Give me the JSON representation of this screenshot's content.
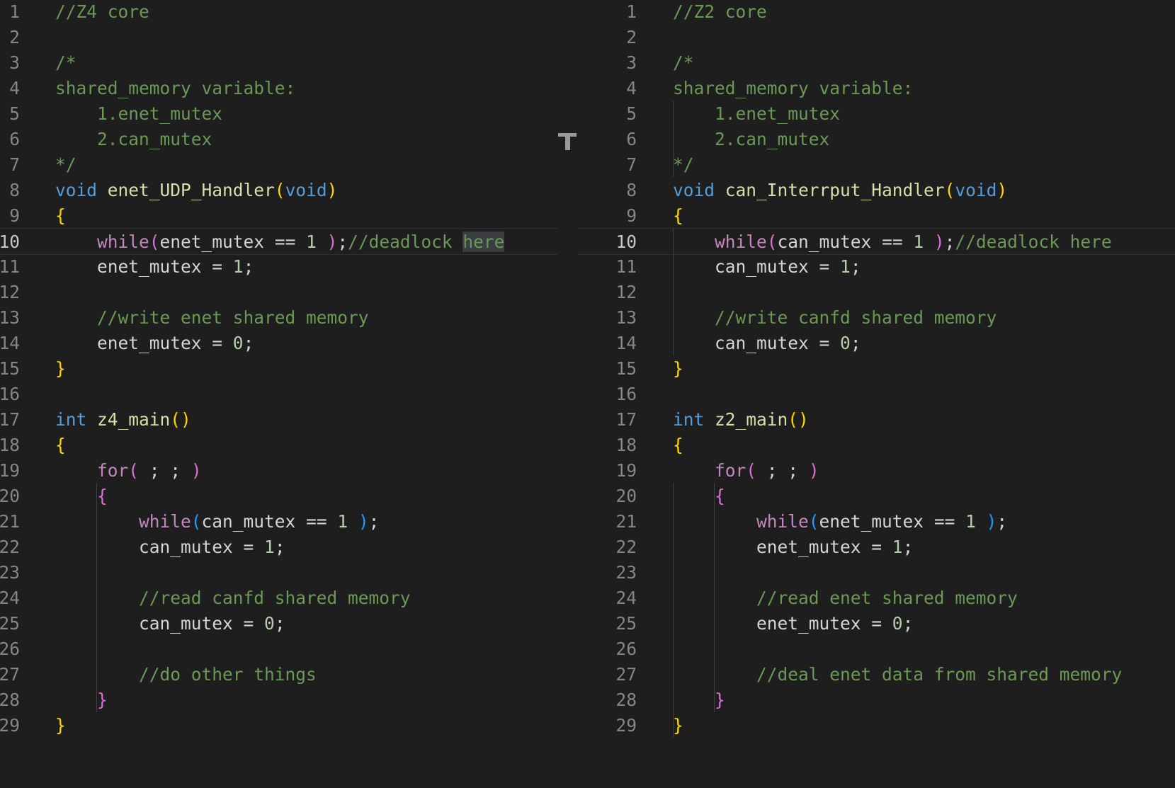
{
  "colors": {
    "background": "#1e1e1e",
    "comment": "#6a9955",
    "keyword": "#569cd6",
    "control": "#c586c0",
    "function": "#dcdcaa",
    "number": "#b5cea8",
    "text": "#d4d4d4",
    "bracket_level1": "#ffd700",
    "bracket_level2": "#da70d6",
    "bracket_level3": "#179fff",
    "line_number": "#858585",
    "line_number_active": "#c6c6c6",
    "highlight": "#3a3d41"
  },
  "icons": {
    "split_handle": "sash-handle-icon"
  },
  "panes": [
    {
      "id": "left",
      "current_line": 10,
      "highlight_word": "here",
      "lines": [
        {
          "n": "1",
          "tokens": [
            {
              "t": "//Z4 core",
              "c": "cm"
            }
          ]
        },
        {
          "n": "2",
          "tokens": []
        },
        {
          "n": "3",
          "tokens": [
            {
              "t": "/*",
              "c": "cm"
            }
          ]
        },
        {
          "n": "4",
          "tokens": [
            {
              "t": "shared_memory variable:",
              "c": "cm"
            }
          ]
        },
        {
          "n": "5",
          "tokens": [
            {
              "t": "    1.enet_mutex",
              "c": "cm"
            }
          ]
        },
        {
          "n": "6",
          "tokens": [
            {
              "t": "    2.can_mutex",
              "c": "cm"
            }
          ]
        },
        {
          "n": "7",
          "tokens": [
            {
              "t": "*/",
              "c": "cm"
            }
          ]
        },
        {
          "n": "8",
          "tokens": [
            {
              "t": "void",
              "c": "kw"
            },
            {
              "t": " ",
              "c": "p"
            },
            {
              "t": "enet_UDP_Handler",
              "c": "fn"
            },
            {
              "t": "(",
              "c": "b1"
            },
            {
              "t": "void",
              "c": "kw"
            },
            {
              "t": ")",
              "c": "b1"
            }
          ]
        },
        {
          "n": "9",
          "tokens": [
            {
              "t": "{",
              "c": "b1"
            }
          ]
        },
        {
          "n": "10",
          "tokens": [
            {
              "t": "    ",
              "c": "p"
            },
            {
              "t": "while",
              "c": "ctl"
            },
            {
              "t": "(",
              "c": "b2"
            },
            {
              "t": "enet_mutex",
              "c": "var"
            },
            {
              "t": " == ",
              "c": "p"
            },
            {
              "t": "1",
              "c": "num"
            },
            {
              "t": " ",
              "c": "p"
            },
            {
              "t": ")",
              "c": "b2"
            },
            {
              "t": ";",
              "c": "p"
            },
            {
              "t": "//deadlock ",
              "c": "cm"
            },
            {
              "t": "here",
              "c": "cm",
              "hl": true
            }
          ]
        },
        {
          "n": "11",
          "tokens": [
            {
              "t": "    ",
              "c": "p"
            },
            {
              "t": "enet_mutex",
              "c": "var"
            },
            {
              "t": " = ",
              "c": "p"
            },
            {
              "t": "1",
              "c": "num"
            },
            {
              "t": ";",
              "c": "p"
            }
          ]
        },
        {
          "n": "12",
          "tokens": []
        },
        {
          "n": "13",
          "tokens": [
            {
              "t": "    ",
              "c": "p"
            },
            {
              "t": "//write enet shared memory",
              "c": "cm"
            }
          ]
        },
        {
          "n": "14",
          "tokens": [
            {
              "t": "    ",
              "c": "p"
            },
            {
              "t": "enet_mutex",
              "c": "var"
            },
            {
              "t": " = ",
              "c": "p"
            },
            {
              "t": "0",
              "c": "num"
            },
            {
              "t": ";",
              "c": "p"
            }
          ]
        },
        {
          "n": "15",
          "tokens": [
            {
              "t": "}",
              "c": "b1"
            }
          ]
        },
        {
          "n": "16",
          "tokens": []
        },
        {
          "n": "17",
          "tokens": [
            {
              "t": "int",
              "c": "kw"
            },
            {
              "t": " ",
              "c": "p"
            },
            {
              "t": "z4_main",
              "c": "fn"
            },
            {
              "t": "()",
              "c": "b1"
            }
          ]
        },
        {
          "n": "18",
          "tokens": [
            {
              "t": "{",
              "c": "b1"
            }
          ]
        },
        {
          "n": "19",
          "tokens": [
            {
              "t": "    ",
              "c": "p"
            },
            {
              "t": "for",
              "c": "ctl"
            },
            {
              "t": "(",
              "c": "b2"
            },
            {
              "t": " ; ; ",
              "c": "p"
            },
            {
              "t": ")",
              "c": "b2"
            }
          ]
        },
        {
          "n": "20",
          "tokens": [
            {
              "t": "    ",
              "c": "p"
            },
            {
              "t": "{",
              "c": "b2"
            }
          ]
        },
        {
          "n": "21",
          "tokens": [
            {
              "t": "        ",
              "c": "p"
            },
            {
              "t": "while",
              "c": "ctl"
            },
            {
              "t": "(",
              "c": "b3"
            },
            {
              "t": "can_mutex",
              "c": "var"
            },
            {
              "t": " == ",
              "c": "p"
            },
            {
              "t": "1",
              "c": "num"
            },
            {
              "t": " ",
              "c": "p"
            },
            {
              "t": ")",
              "c": "b3"
            },
            {
              "t": ";",
              "c": "p"
            }
          ]
        },
        {
          "n": "22",
          "tokens": [
            {
              "t": "        ",
              "c": "p"
            },
            {
              "t": "can_mutex",
              "c": "var"
            },
            {
              "t": " = ",
              "c": "p"
            },
            {
              "t": "1",
              "c": "num"
            },
            {
              "t": ";",
              "c": "p"
            }
          ]
        },
        {
          "n": "23",
          "tokens": []
        },
        {
          "n": "24",
          "tokens": [
            {
              "t": "        ",
              "c": "p"
            },
            {
              "t": "//read canfd shared memory",
              "c": "cm"
            }
          ]
        },
        {
          "n": "25",
          "tokens": [
            {
              "t": "        ",
              "c": "p"
            },
            {
              "t": "can_mutex",
              "c": "var"
            },
            {
              "t": " = ",
              "c": "p"
            },
            {
              "t": "0",
              "c": "num"
            },
            {
              "t": ";",
              "c": "p"
            }
          ]
        },
        {
          "n": "26",
          "tokens": []
        },
        {
          "n": "27",
          "tokens": [
            {
              "t": "        ",
              "c": "p"
            },
            {
              "t": "//do other things",
              "c": "cm"
            }
          ]
        },
        {
          "n": "28",
          "tokens": [
            {
              "t": "    ",
              "c": "p"
            },
            {
              "t": "}",
              "c": "b2"
            }
          ]
        },
        {
          "n": "29",
          "tokens": [
            {
              "t": "}",
              "c": "b1"
            }
          ]
        }
      ]
    },
    {
      "id": "right",
      "current_line": 10,
      "highlight_word": "",
      "lines": [
        {
          "n": "1",
          "tokens": [
            {
              "t": "//Z2 core",
              "c": "cm"
            }
          ]
        },
        {
          "n": "2",
          "tokens": []
        },
        {
          "n": "3",
          "tokens": [
            {
              "t": "/*",
              "c": "cm"
            }
          ]
        },
        {
          "n": "4",
          "tokens": [
            {
              "t": "shared_memory variable:",
              "c": "cm"
            }
          ]
        },
        {
          "n": "5",
          "tokens": [
            {
              "t": "    1.enet_mutex",
              "c": "cm"
            }
          ]
        },
        {
          "n": "6",
          "tokens": [
            {
              "t": "    2.can_mutex",
              "c": "cm"
            }
          ]
        },
        {
          "n": "7",
          "tokens": [
            {
              "t": "*/",
              "c": "cm"
            }
          ]
        },
        {
          "n": "8",
          "tokens": [
            {
              "t": "void",
              "c": "kw"
            },
            {
              "t": " ",
              "c": "p"
            },
            {
              "t": "can_Interrput_Handler",
              "c": "fn"
            },
            {
              "t": "(",
              "c": "b1"
            },
            {
              "t": "void",
              "c": "kw"
            },
            {
              "t": ")",
              "c": "b1"
            }
          ]
        },
        {
          "n": "9",
          "tokens": [
            {
              "t": "{",
              "c": "b1"
            }
          ]
        },
        {
          "n": "10",
          "tokens": [
            {
              "t": "    ",
              "c": "p"
            },
            {
              "t": "while",
              "c": "ctl"
            },
            {
              "t": "(",
              "c": "b2"
            },
            {
              "t": "can_mutex",
              "c": "var"
            },
            {
              "t": " == ",
              "c": "p"
            },
            {
              "t": "1",
              "c": "num"
            },
            {
              "t": " ",
              "c": "p"
            },
            {
              "t": ")",
              "c": "b2"
            },
            {
              "t": ";",
              "c": "p"
            },
            {
              "t": "//deadlock here",
              "c": "cm"
            }
          ]
        },
        {
          "n": "11",
          "tokens": [
            {
              "t": "    ",
              "c": "p"
            },
            {
              "t": "can_mutex",
              "c": "var"
            },
            {
              "t": " = ",
              "c": "p"
            },
            {
              "t": "1",
              "c": "num"
            },
            {
              "t": ";",
              "c": "p"
            }
          ]
        },
        {
          "n": "12",
          "tokens": []
        },
        {
          "n": "13",
          "tokens": [
            {
              "t": "    ",
              "c": "p"
            },
            {
              "t": "//write canfd shared memory",
              "c": "cm"
            }
          ]
        },
        {
          "n": "14",
          "tokens": [
            {
              "t": "    ",
              "c": "p"
            },
            {
              "t": "can_mutex",
              "c": "var"
            },
            {
              "t": " = ",
              "c": "p"
            },
            {
              "t": "0",
              "c": "num"
            },
            {
              "t": ";",
              "c": "p"
            }
          ]
        },
        {
          "n": "15",
          "tokens": [
            {
              "t": "}",
              "c": "b1"
            }
          ]
        },
        {
          "n": "16",
          "tokens": []
        },
        {
          "n": "17",
          "tokens": [
            {
              "t": "int",
              "c": "kw"
            },
            {
              "t": " ",
              "c": "p"
            },
            {
              "t": "z2_main",
              "c": "fn"
            },
            {
              "t": "()",
              "c": "b1"
            }
          ]
        },
        {
          "n": "18",
          "tokens": [
            {
              "t": "{",
              "c": "b1"
            }
          ]
        },
        {
          "n": "19",
          "tokens": [
            {
              "t": "    ",
              "c": "p"
            },
            {
              "t": "for",
              "c": "ctl"
            },
            {
              "t": "(",
              "c": "b2"
            },
            {
              "t": " ; ; ",
              "c": "p"
            },
            {
              "t": ")",
              "c": "b2"
            }
          ]
        },
        {
          "n": "20",
          "tokens": [
            {
              "t": "    ",
              "c": "p"
            },
            {
              "t": "{",
              "c": "b2"
            }
          ]
        },
        {
          "n": "21",
          "tokens": [
            {
              "t": "        ",
              "c": "p"
            },
            {
              "t": "while",
              "c": "ctl"
            },
            {
              "t": "(",
              "c": "b3"
            },
            {
              "t": "enet_mutex",
              "c": "var"
            },
            {
              "t": " == ",
              "c": "p"
            },
            {
              "t": "1",
              "c": "num"
            },
            {
              "t": " ",
              "c": "p"
            },
            {
              "t": ")",
              "c": "b3"
            },
            {
              "t": ";",
              "c": "p"
            }
          ]
        },
        {
          "n": "22",
          "tokens": [
            {
              "t": "        ",
              "c": "p"
            },
            {
              "t": "enet_mutex",
              "c": "var"
            },
            {
              "t": " = ",
              "c": "p"
            },
            {
              "t": "1",
              "c": "num"
            },
            {
              "t": ";",
              "c": "p"
            }
          ]
        },
        {
          "n": "23",
          "tokens": []
        },
        {
          "n": "24",
          "tokens": [
            {
              "t": "        ",
              "c": "p"
            },
            {
              "t": "//read enet shared memory",
              "c": "cm"
            }
          ]
        },
        {
          "n": "25",
          "tokens": [
            {
              "t": "        ",
              "c": "p"
            },
            {
              "t": "enet_mutex",
              "c": "var"
            },
            {
              "t": " = ",
              "c": "p"
            },
            {
              "t": "0",
              "c": "num"
            },
            {
              "t": ";",
              "c": "p"
            }
          ]
        },
        {
          "n": "26",
          "tokens": []
        },
        {
          "n": "27",
          "tokens": [
            {
              "t": "        ",
              "c": "p"
            },
            {
              "t": "//deal enet data from shared memory",
              "c": "cm"
            }
          ]
        },
        {
          "n": "28",
          "tokens": [
            {
              "t": "    ",
              "c": "p"
            },
            {
              "t": "}",
              "c": "b2"
            }
          ]
        },
        {
          "n": "29",
          "tokens": [
            {
              "t": "}",
              "c": "b1"
            }
          ]
        }
      ]
    }
  ]
}
